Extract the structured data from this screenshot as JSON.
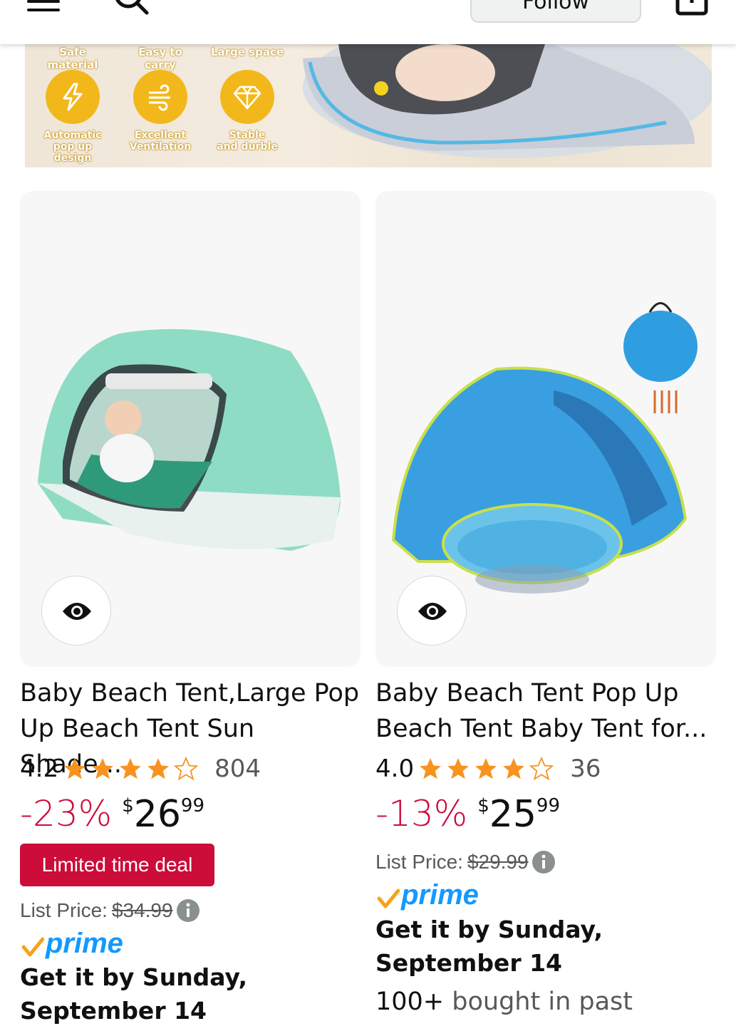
{
  "header": {
    "follow_label": "Follow"
  },
  "banner": {
    "top_labels": [
      "Safe material",
      "Easy to carry",
      "Large space"
    ],
    "features": [
      {
        "label_line1": "Automatic",
        "label_line2": "pop up design",
        "icon": "lightning-icon"
      },
      {
        "label_line1": "Excellent",
        "label_line2": "Ventilation",
        "icon": "wind-icon"
      },
      {
        "label_line1": "Stable",
        "label_line2": "and durble",
        "icon": "diamond-icon"
      }
    ]
  },
  "products": [
    {
      "title_line1": "Baby Beach Tent,Large Pop",
      "title_line2": "Up Beach Tent Sun Shade...",
      "rating": "4.2",
      "rating_stars": 4.2,
      "review_count": "804",
      "discount": "-23%",
      "currency": "$",
      "price_whole": "26",
      "price_fraction": "99",
      "deal_label": "Limited time deal",
      "list_price_label": "List Price:",
      "list_price": "$34.99",
      "prime_label": "prime",
      "delivery_line1": "Get it by Sunday,",
      "delivery_line2": "September 14",
      "image": "green-baby-tent",
      "tent_color": "#8fdcc4"
    },
    {
      "title_line1": "Baby Beach Tent Pop Up",
      "title_line2": "Beach Tent Baby Tent for...",
      "rating": "4.0",
      "rating_stars": 4.0,
      "review_count": "36",
      "discount": "-13%",
      "currency": "$",
      "price_whole": "25",
      "price_fraction": "99",
      "list_price_label": "List Price:",
      "list_price": "$29.99",
      "prime_label": "prime",
      "delivery_line1": "Get it by Sunday,",
      "delivery_line2": "September 14",
      "bought_prefix": "100+",
      "bought_suffix": "bought in past",
      "image": "blue-pool-tent",
      "tent_color": "#3aa0e0"
    }
  ],
  "colors": {
    "deal_red": "#cc0c39",
    "prime_blue": "#1399ff",
    "star_orange": "#f7931e",
    "feature_yellow": "#f2b81b"
  }
}
